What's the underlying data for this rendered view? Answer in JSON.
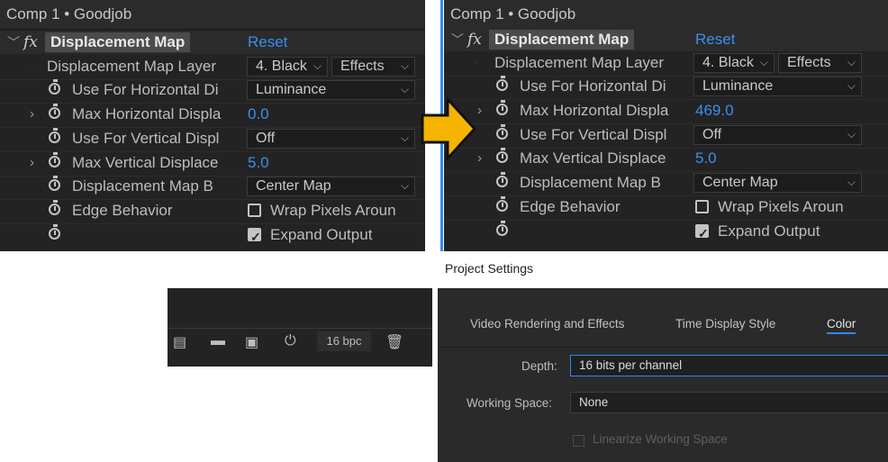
{
  "left_panel": {
    "comp_header": "Comp 1 • Goodjob",
    "effect": {
      "name": "Displacement Map",
      "reset": "Reset"
    },
    "rows": [
      {
        "label": "Displacement Map Layer",
        "layer": "4. Black",
        "source": "Effects"
      },
      {
        "label": "Use For Horizontal Di",
        "dropdown": "Luminance"
      },
      {
        "label": "Max Horizontal Displa",
        "value": "0.0"
      },
      {
        "label": "Use For Vertical Displ",
        "dropdown": "Off"
      },
      {
        "label": "Max Vertical Displace",
        "value": "5.0"
      },
      {
        "label": "Displacement Map B",
        "dropdown": "Center Map"
      },
      {
        "label": "Edge Behavior",
        "checkbox_label": "Wrap Pixels Aroun",
        "checked": false
      },
      {
        "label": "",
        "checkbox_label": "Expand Output",
        "checked": true
      }
    ]
  },
  "right_panel": {
    "comp_header": "Comp 1 • Goodjob",
    "effect": {
      "name": "Displacement Map",
      "reset": "Reset"
    },
    "rows": [
      {
        "label": "Displacement Map Layer",
        "layer": "4. Black",
        "source": "Effects"
      },
      {
        "label": "Use For Horizontal Di",
        "dropdown": "Luminance"
      },
      {
        "label": "Max Horizontal Displa",
        "value": "469.0"
      },
      {
        "label": "Use For Vertical Displ",
        "dropdown": "Off"
      },
      {
        "label": "Max Vertical Displace",
        "value": "5.0"
      },
      {
        "label": "Displacement Map B",
        "dropdown": "Center Map"
      },
      {
        "label": "Edge Behavior",
        "checkbox_label": "Wrap Pixels Aroun",
        "checked": false
      },
      {
        "label": "",
        "checkbox_label": "Expand Output",
        "checked": true
      }
    ]
  },
  "project_panel": {
    "bit_depth": "16 bpc"
  },
  "project_settings": {
    "title": "Project Settings",
    "tabs": [
      "Video Rendering and Effects",
      "Time Display Style",
      "Color"
    ],
    "active_tab": "Color",
    "depth_label": "Depth:",
    "depth_value": "16 bits per channel",
    "working_space_label": "Working Space:",
    "working_space_value": "None",
    "linearize_label": "Linearize Working Space"
  },
  "colors": {
    "accent_blue": "#3a8ef0",
    "highlight_yellow": "#f5b400",
    "panel_bg": "#232323"
  },
  "icons": [
    "twirl-down-icon",
    "fx-icon",
    "stopwatch-icon",
    "twirl-right-icon",
    "chevron-down-icon",
    "checkbox-icon",
    "arrow-right-icon",
    "interpret-footage-icon",
    "folder-icon",
    "composition-icon",
    "flowchart-icon",
    "trash-icon"
  ]
}
